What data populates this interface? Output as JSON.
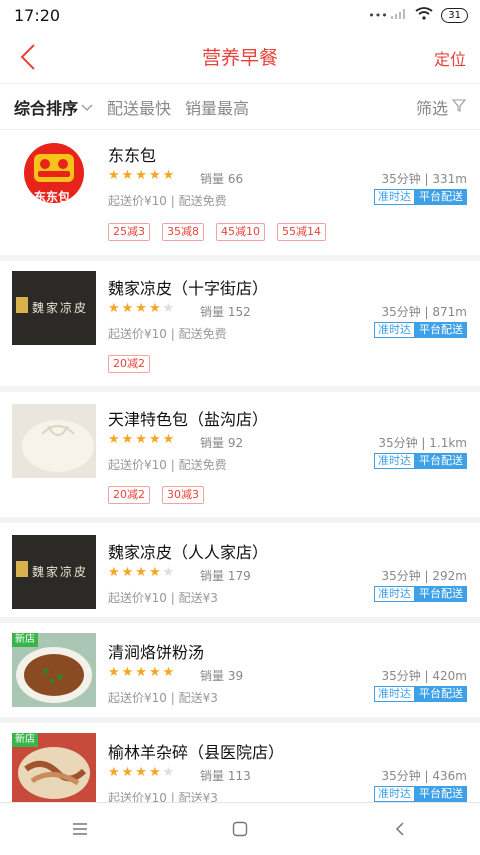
{
  "status": {
    "time": "17:20",
    "battery": "31"
  },
  "header": {
    "title": "营养早餐",
    "right": "定位"
  },
  "sort": {
    "tabs": [
      "综合排序",
      "配送最快",
      "销量最高"
    ],
    "filter": "筛选"
  },
  "shops": [
    {
      "name": "东东包",
      "rating": 5,
      "sales": "销量 66",
      "time_dist": "35分钟 | 331m",
      "min_fee": "起送价¥10 | 配送免费",
      "badge1": "准时达",
      "badge2": "平台配送",
      "promos": [
        "25减3",
        "35减8",
        "45减10",
        "55减14"
      ],
      "new": "",
      "logo_text": "东东包"
    },
    {
      "name": "魏家凉皮（十字街店）",
      "rating": 4.5,
      "sales": "销量 152",
      "time_dist": "35分钟 | 871m",
      "min_fee": "起送价¥10 | 配送免费",
      "badge1": "准时达",
      "badge2": "平台配送",
      "promos": [
        "20减2"
      ],
      "new": "",
      "logo_text": "魏家凉皮"
    },
    {
      "name": "天津特色包（盐沟店）",
      "rating": 5,
      "sales": "销量 92",
      "time_dist": "35分钟 | 1.1km",
      "min_fee": "起送价¥10 | 配送免费",
      "badge1": "准时达",
      "badge2": "平台配送",
      "promos": [
        "20减2",
        "30减3"
      ],
      "new": ""
    },
    {
      "name": "魏家凉皮（人人家店）",
      "rating": 4.5,
      "sales": "销量 179",
      "time_dist": "35分钟 | 292m",
      "min_fee": "起送价¥10 | 配送¥3",
      "badge1": "准时达",
      "badge2": "平台配送",
      "promos": [],
      "new": "",
      "logo_text": "魏家凉皮"
    },
    {
      "name": "清涧烙饼粉汤",
      "rating": 5,
      "sales": "销量 39",
      "time_dist": "35分钟 | 420m",
      "min_fee": "起送价¥10 | 配送¥3",
      "badge1": "准时达",
      "badge2": "平台配送",
      "promos": [],
      "new": "新店"
    },
    {
      "name": "榆林羊杂碎（县医院店）",
      "rating": 4.5,
      "sales": "销量 113",
      "time_dist": "35分钟 | 436m",
      "min_fee": "起送价¥10 | 配送¥3",
      "badge1": "准时达",
      "badge2": "平台配送",
      "promos": [],
      "new": "新店"
    }
  ],
  "colors": {
    "accent": "#e8433b",
    "blue": "#3ea0e6",
    "star": "#f5a623",
    "new": "#3ab54a"
  },
  "icons": [
    "back-arrow-icon",
    "chevron-down-icon",
    "filter-icon",
    "menu-icon",
    "home-square-icon",
    "back-chevron-icon",
    "signal-icon",
    "wifi-icon"
  ]
}
